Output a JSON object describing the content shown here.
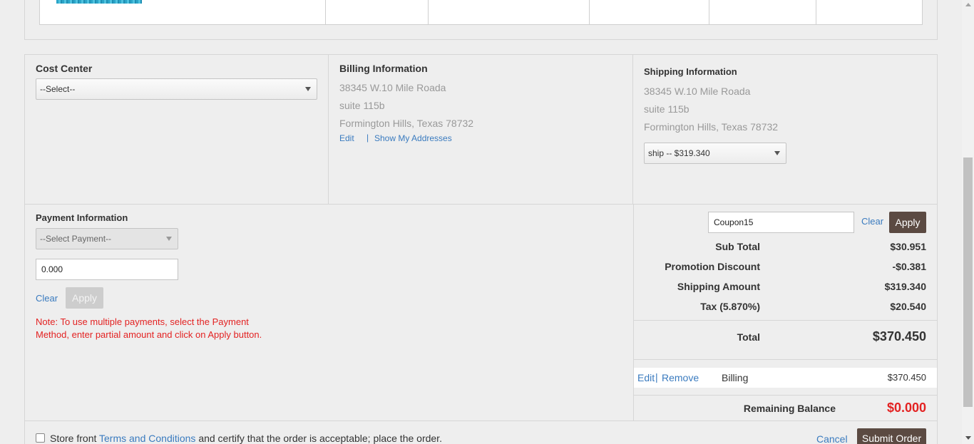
{
  "cost_center": {
    "label": "Cost Center",
    "select_value": "--Select--"
  },
  "billing": {
    "title": "Billing Information",
    "line1": "38345 W.10 Mile Roada",
    "line2": "suite 115b",
    "line3": "Formington Hills, Texas 78732",
    "edit_label": "Edit",
    "separator": "|",
    "show_addresses_label": "Show My Addresses"
  },
  "shipping": {
    "title": "Shipping Information",
    "line1": "38345 W.10 Mile Roada",
    "line2": "suite 115b",
    "line3": "Formington Hills, Texas 78732",
    "method_value": "ship -- $319.340"
  },
  "payment": {
    "title": "Payment Information",
    "select_value": "--Select Payment--",
    "amount_value": "0.000",
    "clear_label": "Clear",
    "apply_label": "Apply",
    "note": "Note: To use multiple payments, select the Payment Method, enter partial amount and click on Apply button."
  },
  "coupon": {
    "value": "Coupon15",
    "clear_label": "Clear",
    "apply_label": "Apply"
  },
  "summary": {
    "subtotal_label": "Sub Total",
    "subtotal_value": "$30.951",
    "promo_label": "Promotion Discount",
    "promo_value": "-$0.381",
    "shipping_label": "Shipping Amount",
    "shipping_value": "$319.340",
    "tax_label": "Tax (5.870%)",
    "tax_value": "$20.540",
    "total_label": "Total",
    "total_value": "$370.450"
  },
  "applied_payment": {
    "edit_label": "Edit",
    "separator": "|",
    "remove_label": "Remove",
    "method": "Billing",
    "amount": "$370.450"
  },
  "remaining": {
    "label": "Remaining Balance",
    "value": "$0.000"
  },
  "footer": {
    "terms_prefix": "Store front",
    "terms_link": "Terms and Conditions",
    "terms_suffix": "and certify that the order is acceptable; place the order.",
    "cancel_label": "Cancel",
    "submit_label": "Submit Order"
  },
  "colors": {
    "accent_button": "#5b4a42",
    "link": "#3a7bbf",
    "warning_red": "#e32222"
  }
}
